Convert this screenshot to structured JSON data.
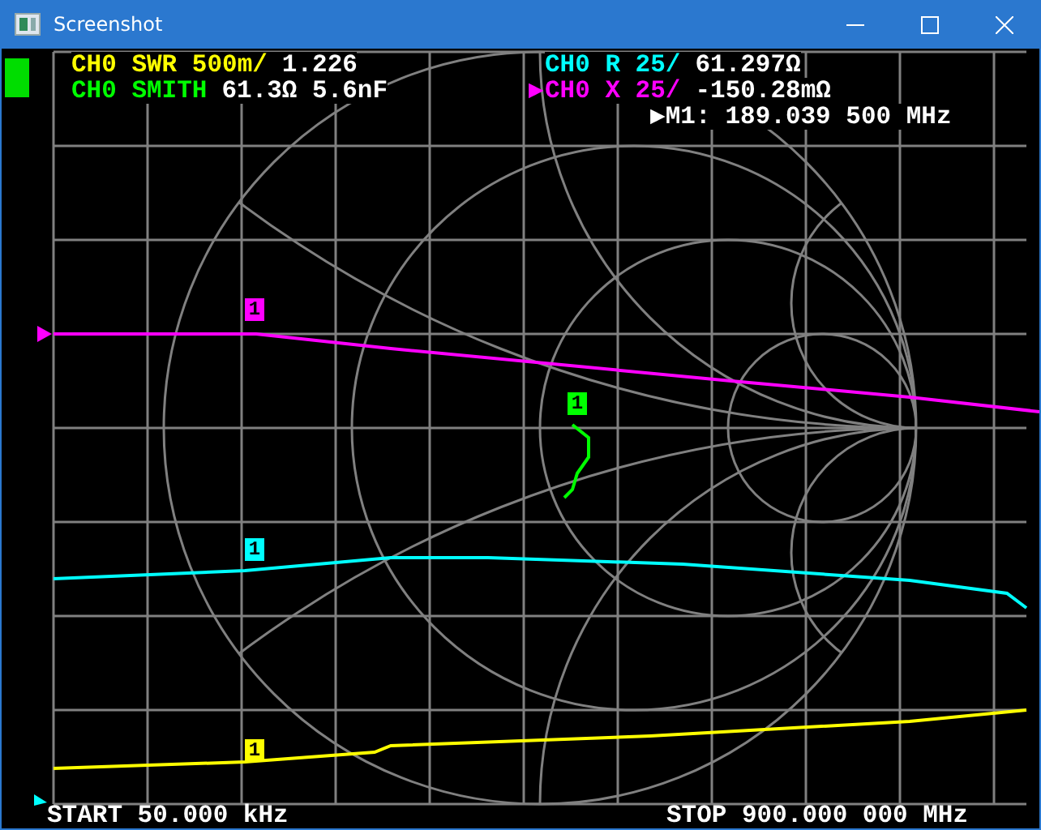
{
  "window": {
    "title": "Screenshot"
  },
  "traces": [
    {
      "name": "CH0 SWR 500m/",
      "value": "1.226",
      "color": "#ffff00",
      "active": false
    },
    {
      "name": "CH0 R 25/",
      "value": "61.297Ω",
      "color": "#00ffff",
      "active": false
    },
    {
      "name": "CH0 SMITH",
      "value": "61.3Ω 5.6nF",
      "color": "#00ff00",
      "active": false
    },
    {
      "name": "CH0 X 25/",
      "value": "-150.28mΩ",
      "color": "#ff00ff",
      "active": true
    }
  ],
  "active_marker": {
    "arrow": "▶",
    "label": "M1:",
    "frequency": "189.039 500 MHz"
  },
  "markers": [
    {
      "label": "1",
      "color": "#ff00ff"
    },
    {
      "label": "1",
      "color": "#00ff00"
    },
    {
      "label": "1",
      "color": "#00ffff"
    },
    {
      "label": "1",
      "color": "#ffff00"
    }
  ],
  "footer": {
    "start": "START 50.000 kHz",
    "stop": "STOP 900.000 000 MHz"
  }
}
